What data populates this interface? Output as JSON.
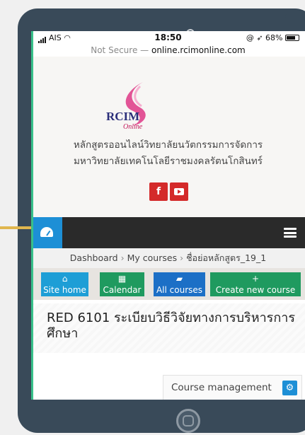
{
  "status_bar": {
    "carrier": "AIS",
    "time": "18:50",
    "battery": "68%"
  },
  "browser": {
    "security_label": "Not Secure —",
    "domain": "online.rcimonline.com"
  },
  "brand": {
    "logo_text": "RCIM",
    "logo_subtext": "Online",
    "title_line1": "หลักสูตรออนไลน์วิทยาลัยนวัตกรรมการจัดการ",
    "title_line2": "มหาวิทยาลัยเทคโนโลยีราชมงคลรัตนโกสินทร์",
    "colors": {
      "social_red": "#d42a2a",
      "nav_blue": "#1d8fd6"
    }
  },
  "social": {
    "facebook_label": "f",
    "youtube_icon": "youtube-icon"
  },
  "breadcrumb": {
    "items": [
      "Dashboard",
      "My courses",
      "ชื่อย่อหลักสูตร_19_1"
    ]
  },
  "quick_buttons": [
    {
      "label": "Site home",
      "icon": "home-icon"
    },
    {
      "label": "Calendar",
      "icon": "calendar-icon"
    },
    {
      "label": "All courses",
      "icon": "book-icon"
    },
    {
      "label": "Create new course",
      "icon": "plus-icon"
    }
  ],
  "course": {
    "title": "RED 6101 ระเบียบวิธีวิจัยทางการบริหารการศึกษา"
  },
  "course_management": {
    "label": "Course management"
  }
}
